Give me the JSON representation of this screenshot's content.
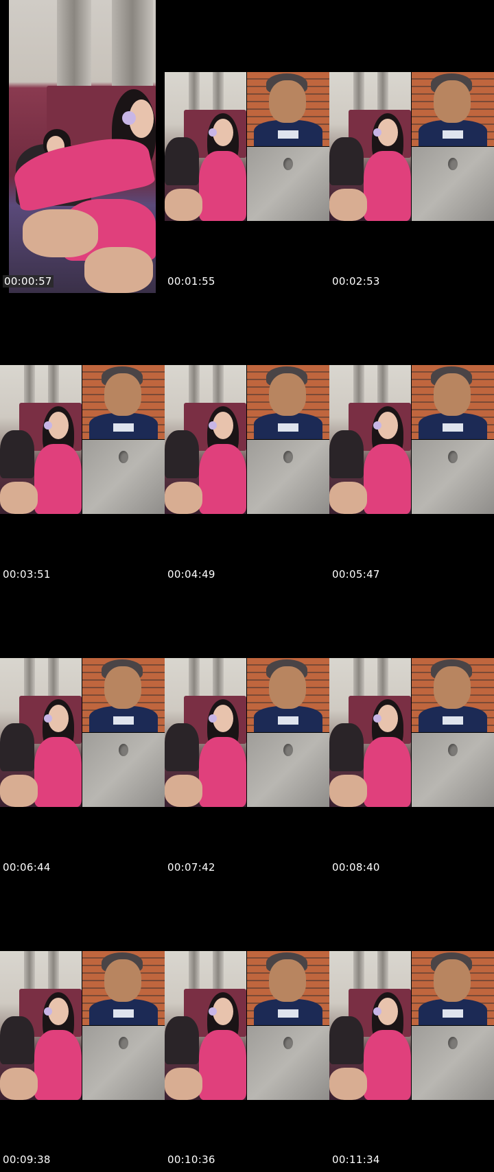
{
  "timestamps": [
    "00:00:57",
    "00:01:55",
    "00:02:53",
    "00:03:51",
    "00:04:49",
    "00:05:47",
    "00:06:44",
    "00:07:42",
    "00:08:40",
    "00:09:38",
    "00:10:36",
    "00:11:34"
  ]
}
